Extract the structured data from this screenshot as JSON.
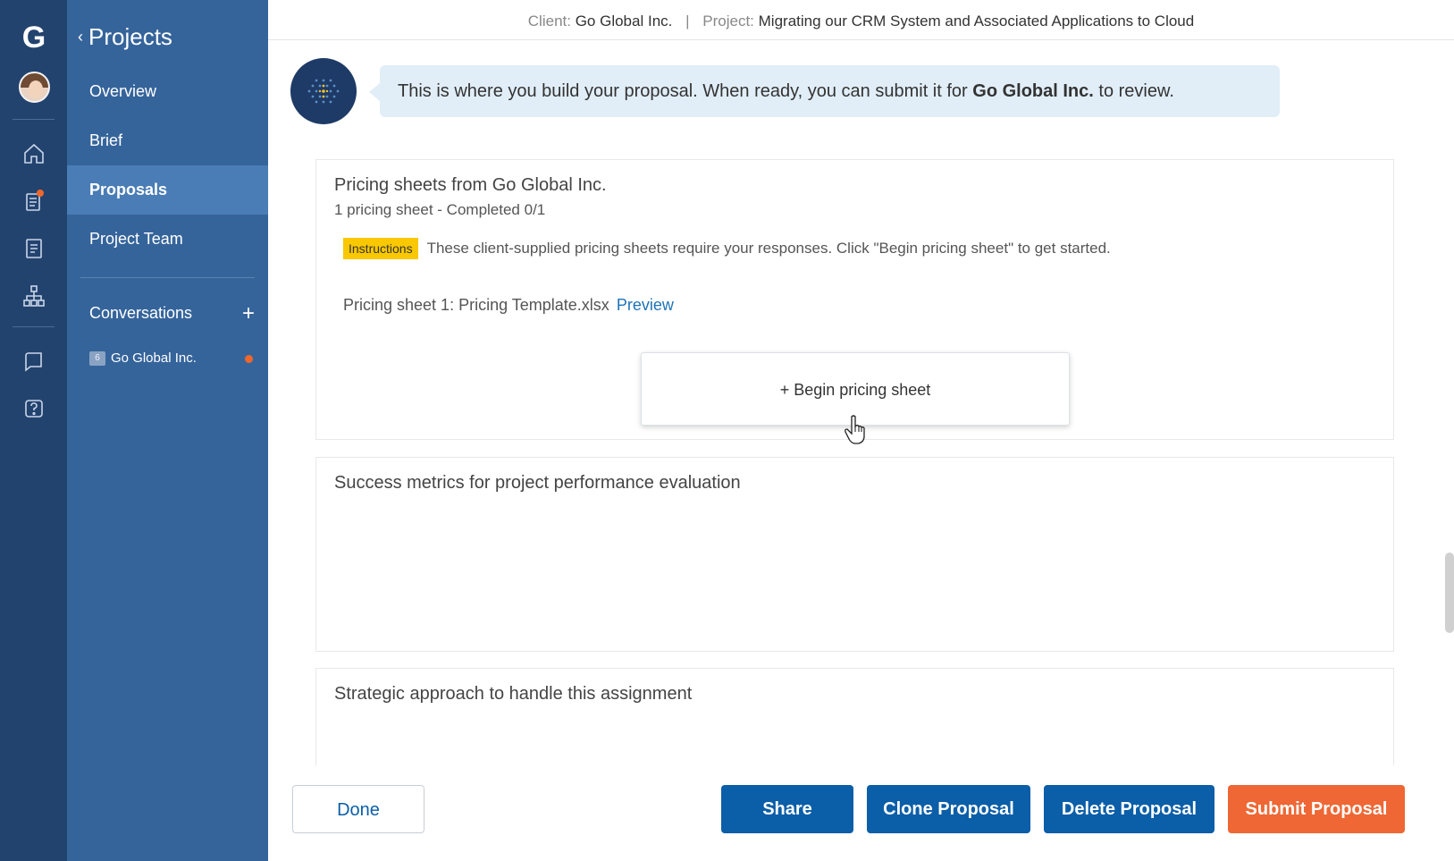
{
  "rail": {
    "logo": "G",
    "icons": [
      "home-icon",
      "proposals-icon",
      "documents-icon",
      "org-chart-icon",
      "chat-icon",
      "help-icon"
    ]
  },
  "nav": {
    "back_label": "Projects",
    "items": [
      {
        "label": "Overview"
      },
      {
        "label": "Brief"
      },
      {
        "label": "Proposals"
      },
      {
        "label": "Project Team"
      }
    ],
    "conversations_label": "Conversations",
    "conversation_items": [
      {
        "badge": "6",
        "label": "Go Global Inc."
      }
    ]
  },
  "topbar": {
    "client_label": "Client:",
    "client_value": "Go Global Inc.",
    "project_label": "Project:",
    "project_value": "Migrating our CRM System and Associated Applications to Cloud"
  },
  "assistant": {
    "message_pre": "This is where you build your proposal. When ready, you can submit it for ",
    "message_bold": "Go Global Inc.",
    "message_post": " to review."
  },
  "pricing": {
    "title": "Pricing sheets from Go Global Inc.",
    "subtitle": "1 pricing sheet - Completed 0/1",
    "instructions_tag": "Instructions",
    "instructions_text": "These client-supplied pricing sheets require your responses. Click \"Begin pricing sheet\" to get started.",
    "sheet_label": "Pricing sheet 1: Pricing Template.xlsx",
    "preview_link": "Preview",
    "begin_button": "+ Begin pricing sheet"
  },
  "sections": [
    {
      "title": "Success metrics for project performance evaluation"
    },
    {
      "title": "Strategic approach to handle this assignment"
    }
  ],
  "actions": {
    "done": "Done",
    "share": "Share",
    "clone": "Clone Proposal",
    "delete": "Delete Proposal",
    "submit": "Submit Proposal"
  },
  "colors": {
    "rail_bg": "#23436f",
    "nav_bg": "#35649b",
    "nav_active": "#4a7db5",
    "primary_button": "#0b5ea8",
    "submit_button": "#ee6734",
    "instructions_tag": "#f9c800",
    "notification_dot": "#f0672b"
  }
}
